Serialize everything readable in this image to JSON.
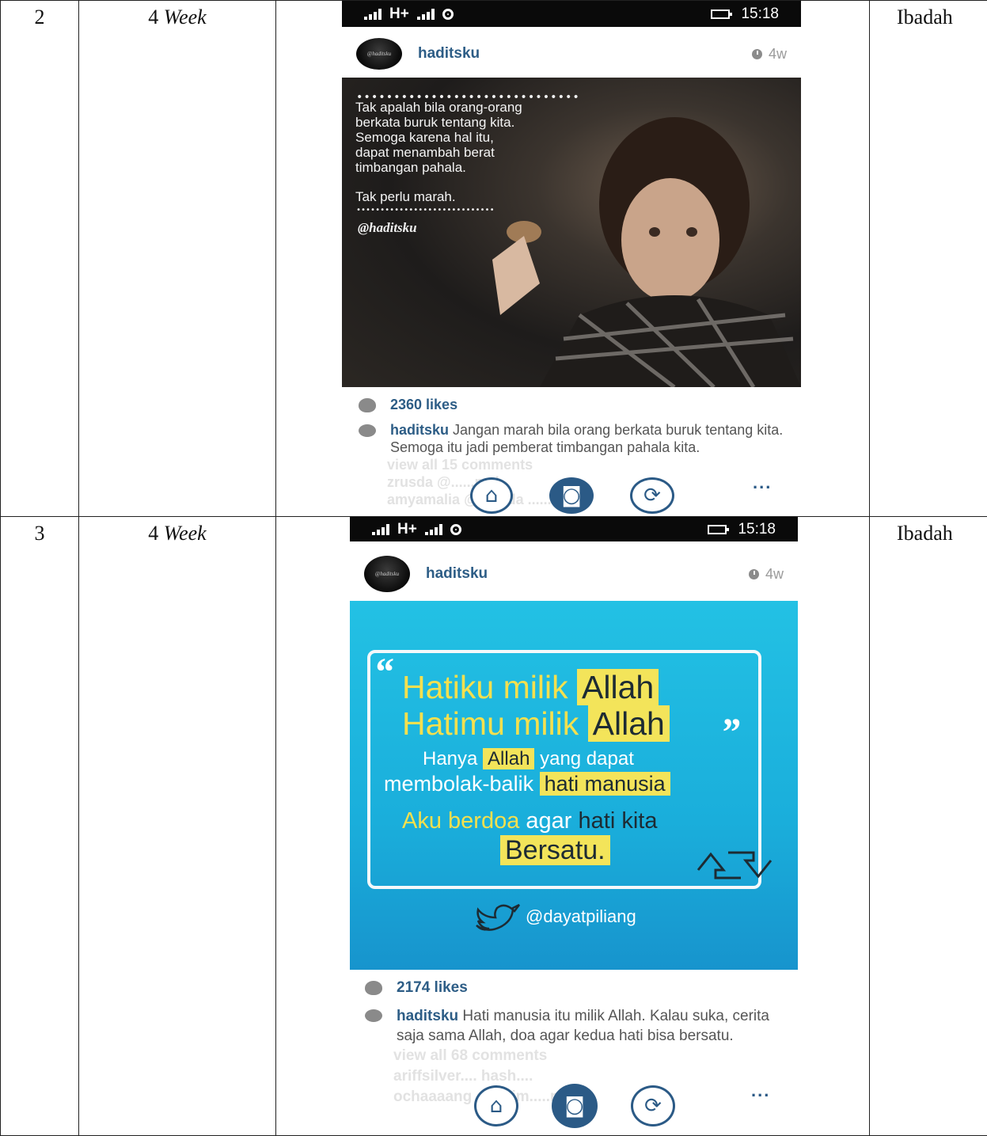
{
  "rows": [
    {
      "no": "2",
      "period_num": "4",
      "period_unit": "Week",
      "category": "Ibadah",
      "post": {
        "status_time": "15:18",
        "network": "H+",
        "username": "haditsku",
        "avatar_text": "@haditsku",
        "age": "4w",
        "image_lines": [
          "Tak apalah bila orang-orang",
          "berkata buruk tentang kita.",
          "Semoga karena hal itu,",
          "dapat menambah berat",
          "timbangan pahala.",
          "",
          "Tak perlu marah."
        ],
        "image_signature": "@haditsku",
        "likes": "2360 likes",
        "caption_user": "haditsku",
        "caption_text": "Jangan marah bila orang berkata buruk tentang kita. Semoga itu jadi pemberat timbangan pahala kita.",
        "faded_lines": [
          "view all 15 comments",
          "zrusda @......mal",
          "amyamalia @zrusda ........"
        ],
        "more": "..."
      }
    },
    {
      "no": "3",
      "period_num": "4",
      "period_unit": "Week",
      "category": "Ibadah",
      "post": {
        "status_time": "15:18",
        "network": "H+",
        "username": "haditsku",
        "avatar_text": "@haditsku",
        "age": "4w",
        "quote": {
          "l1a": "Hatiku milik",
          "l1b": "Allah",
          "l2a": "Hatimu milik",
          "l2b": "Allah",
          "l3a": "Hanya",
          "l3b": "Allah",
          "l3c": "yang dapat",
          "l4a": "membolak-balik",
          "l4b": "hati manusia",
          "l5a": "Aku berdoa",
          "l5b": "agar",
          "l5c": "hati kita",
          "l6": "Bersatu.",
          "twitter": "@dayatpiliang"
        },
        "likes": "2174 likes",
        "caption_user": "haditsku",
        "caption_text": "Hati manusia itu milik Allah. Kalau suka, cerita saja sama Allah, doa agar kedua hati bisa bersatu.",
        "faded_lines": [
          "view all 68 comments",
          "ariffsilver.... hash....",
          "ochaaaang .... @im.....nger"
        ],
        "more": "..."
      }
    }
  ],
  "colors": {
    "brand_blue": "#2b5a86",
    "quote_bg": "#1aaedb",
    "highlight": "#f3e45a"
  }
}
